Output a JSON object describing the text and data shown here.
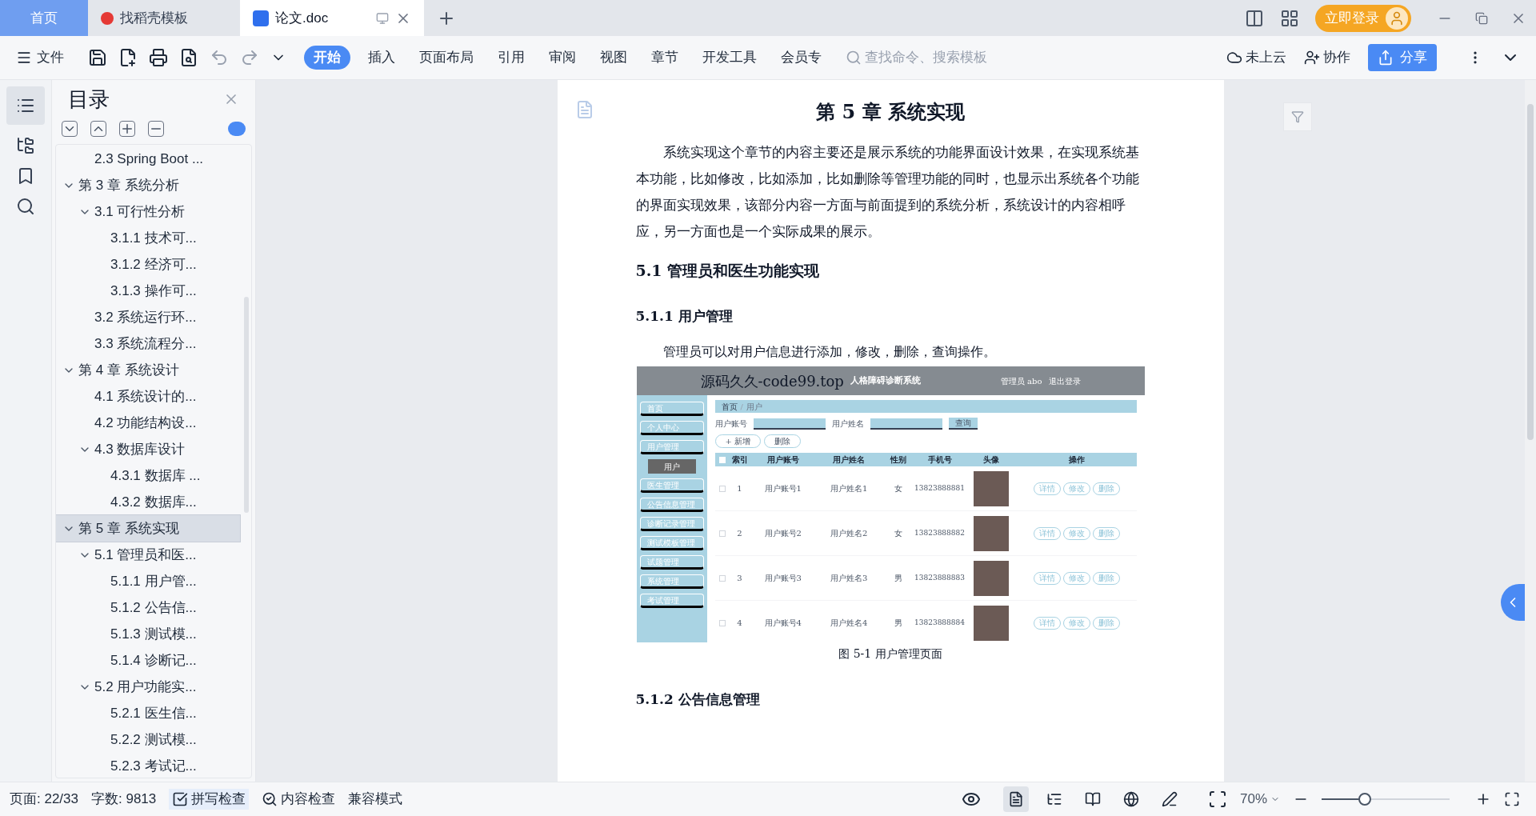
{
  "tabs": [
    {
      "label": "首页",
      "kind": "home",
      "selected": false
    },
    {
      "label": "找稻壳模板",
      "kind": "docer",
      "selected": false
    },
    {
      "label": "论文.doc",
      "kind": "doc",
      "selected": true
    }
  ],
  "login_button": "立即登录",
  "toolbar": {
    "file": "文件",
    "tabs": [
      {
        "label": "开始",
        "selected": true
      },
      {
        "label": "插入",
        "selected": false
      },
      {
        "label": "页面布局",
        "selected": false
      },
      {
        "label": "引用",
        "selected": false
      },
      {
        "label": "审阅",
        "selected": false
      },
      {
        "label": "视图",
        "selected": false
      },
      {
        "label": "章节",
        "selected": false
      },
      {
        "label": "开发工具",
        "selected": false
      },
      {
        "label": "会员专",
        "selected": false
      }
    ],
    "search": {
      "placeholder": "查找命令、搜索模板"
    },
    "cloud": "未上云",
    "collab": "协作",
    "share": "分享"
  },
  "toc": {
    "title": "目录",
    "items": [
      {
        "children": [
          {
            "label": "2.3 Spring Boot ...",
            "selected": false
          }
        ]
      },
      {
        "label": "第 3 章  系统分析",
        "selected": false,
        "expanded": true,
        "children": [
          {
            "label": "3.1 可行性分析",
            "selected": false,
            "expanded": true,
            "children": [
              {
                "label": "3.1.1 技术可...",
                "selected": false
              },
              {
                "label": "3.1.2 经济可...",
                "selected": false
              },
              {
                "label": "3.1.3 操作可...",
                "selected": false
              }
            ]
          },
          {
            "label": "3.2 系统运行环...",
            "selected": false
          },
          {
            "label": "3.3 系统流程分...",
            "selected": false
          }
        ]
      },
      {
        "label": "第 4 章  系统设计",
        "selected": false,
        "expanded": true,
        "children": [
          {
            "label": "4.1  系统设计的...",
            "selected": false
          },
          {
            "label": "4.2  功能结构设...",
            "selected": false
          },
          {
            "label": "4.3  数据库设计",
            "selected": false,
            "expanded": true,
            "children": [
              {
                "label": "4.3.1  数据库 ...",
                "selected": false
              },
              {
                "label": "4.3.2  数据库...",
                "selected": false
              }
            ]
          }
        ]
      },
      {
        "label": "第 5 章  系统实现",
        "selected": true,
        "expanded": true,
        "children": [
          {
            "label": "5.1 管理员和医...",
            "selected": false,
            "expanded": true,
            "children": [
              {
                "label": "5.1.1  用户管...",
                "selected": false
              },
              {
                "label": "5.1.2  公告信...",
                "selected": false
              },
              {
                "label": "5.1.3  测试模...",
                "selected": false
              },
              {
                "label": "5.1.4  诊断记...",
                "selected": false
              }
            ]
          },
          {
            "label": "5.2  用户功能实...",
            "selected": false,
            "expanded": true,
            "children": [
              {
                "label": "5.2.1  医生信...",
                "selected": false
              },
              {
                "label": "5.2.2  测试模...",
                "selected": false
              },
              {
                "label": "5.2.3  考试记...",
                "selected": false
              }
            ]
          }
        ]
      }
    ]
  },
  "document": {
    "title": "第 5 章  系统实现",
    "intro": "系统实现这个章节的内容主要还是展示系统的功能界面设计效果，在实现系统基本功能，比如修改，比如添加，比如删除等管理功能的同时，也显示出系统各个功能的界面实现效果，该部分内容一方面与前面提到的系统分析，系统设计的内容相呼应，另一方面也是一个实际成果的展示。",
    "heading_2": "5.1 管理员和医生功能实现",
    "heading_3": "5.1.1  用户管理",
    "body": "管理员可以对用户信息进行添加，修改，删除，查询操作。",
    "figure": {
      "site": "源码久久-code99.top",
      "system": "人格障碍诊断系统",
      "admin": "管理员 abo",
      "logout": "退出登录",
      "menu": [
        {
          "label": "首页",
          "selected": false
        },
        {
          "label": "个人中心",
          "selected": false
        },
        {
          "label": "用户管理",
          "selected": false
        },
        {
          "label": "用户",
          "selected": true
        },
        {
          "label": "医生管理",
          "selected": false
        },
        {
          "label": "公告信息管理",
          "selected": false
        },
        {
          "label": "诊断记录管理",
          "selected": false
        },
        {
          "label": "测试模板管理",
          "selected": false
        },
        {
          "label": "试题管理",
          "selected": false
        },
        {
          "label": "系统管理",
          "selected": false
        },
        {
          "label": "考试管理",
          "selected": false
        }
      ],
      "breadcrumb": [
        "首页",
        "用户"
      ],
      "breadcrumb_separator": "/",
      "all_checked": false,
      "search_labels": [
        "用户账号",
        "用户姓名"
      ],
      "query": "查询",
      "add": "+ 新增",
      "delete": "删除",
      "columns": [
        "索引",
        "用户账号",
        "用户姓名",
        "性别",
        "手机号",
        "头像",
        "操作"
      ],
      "rows": [
        {
          "checked": false,
          "index": "1",
          "account": "用户账号1",
          "name": "用户姓名1",
          "gender": "女",
          "phone": "13823888881",
          "actions": [
            "详情",
            "修改",
            "删除"
          ]
        },
        {
          "checked": false,
          "index": "2",
          "account": "用户账号2",
          "name": "用户姓名2",
          "gender": "女",
          "phone": "13823888882",
          "actions": [
            "详情",
            "修改",
            "删除"
          ]
        },
        {
          "checked": false,
          "index": "3",
          "account": "用户账号3",
          "name": "用户姓名3",
          "gender": "男",
          "phone": "13823888883",
          "actions": [
            "详情",
            "修改",
            "删除"
          ]
        },
        {
          "checked": false,
          "index": "4",
          "account": "用户账号4",
          "name": "用户姓名4",
          "gender": "男",
          "phone": "13823888884",
          "actions": [
            "详情",
            "修改",
            "删除"
          ]
        }
      ]
    },
    "caption": "图 5-1  用户管理页面",
    "heading_3b": "5.1.2  公告信息管理"
  },
  "status_bar": {
    "page": "页面: 22/33",
    "words": "字数: 9813",
    "spell": "拼写检查",
    "content": "内容检查",
    "mode": "兼容模式",
    "views": [
      {
        "kind": "page",
        "selected": true
      },
      {
        "kind": "outline",
        "selected": false
      },
      {
        "kind": "read",
        "selected": false
      },
      {
        "kind": "web",
        "selected": false
      },
      {
        "kind": "write",
        "selected": false
      }
    ],
    "zoom": "70%",
    "level": 0.34
  }
}
